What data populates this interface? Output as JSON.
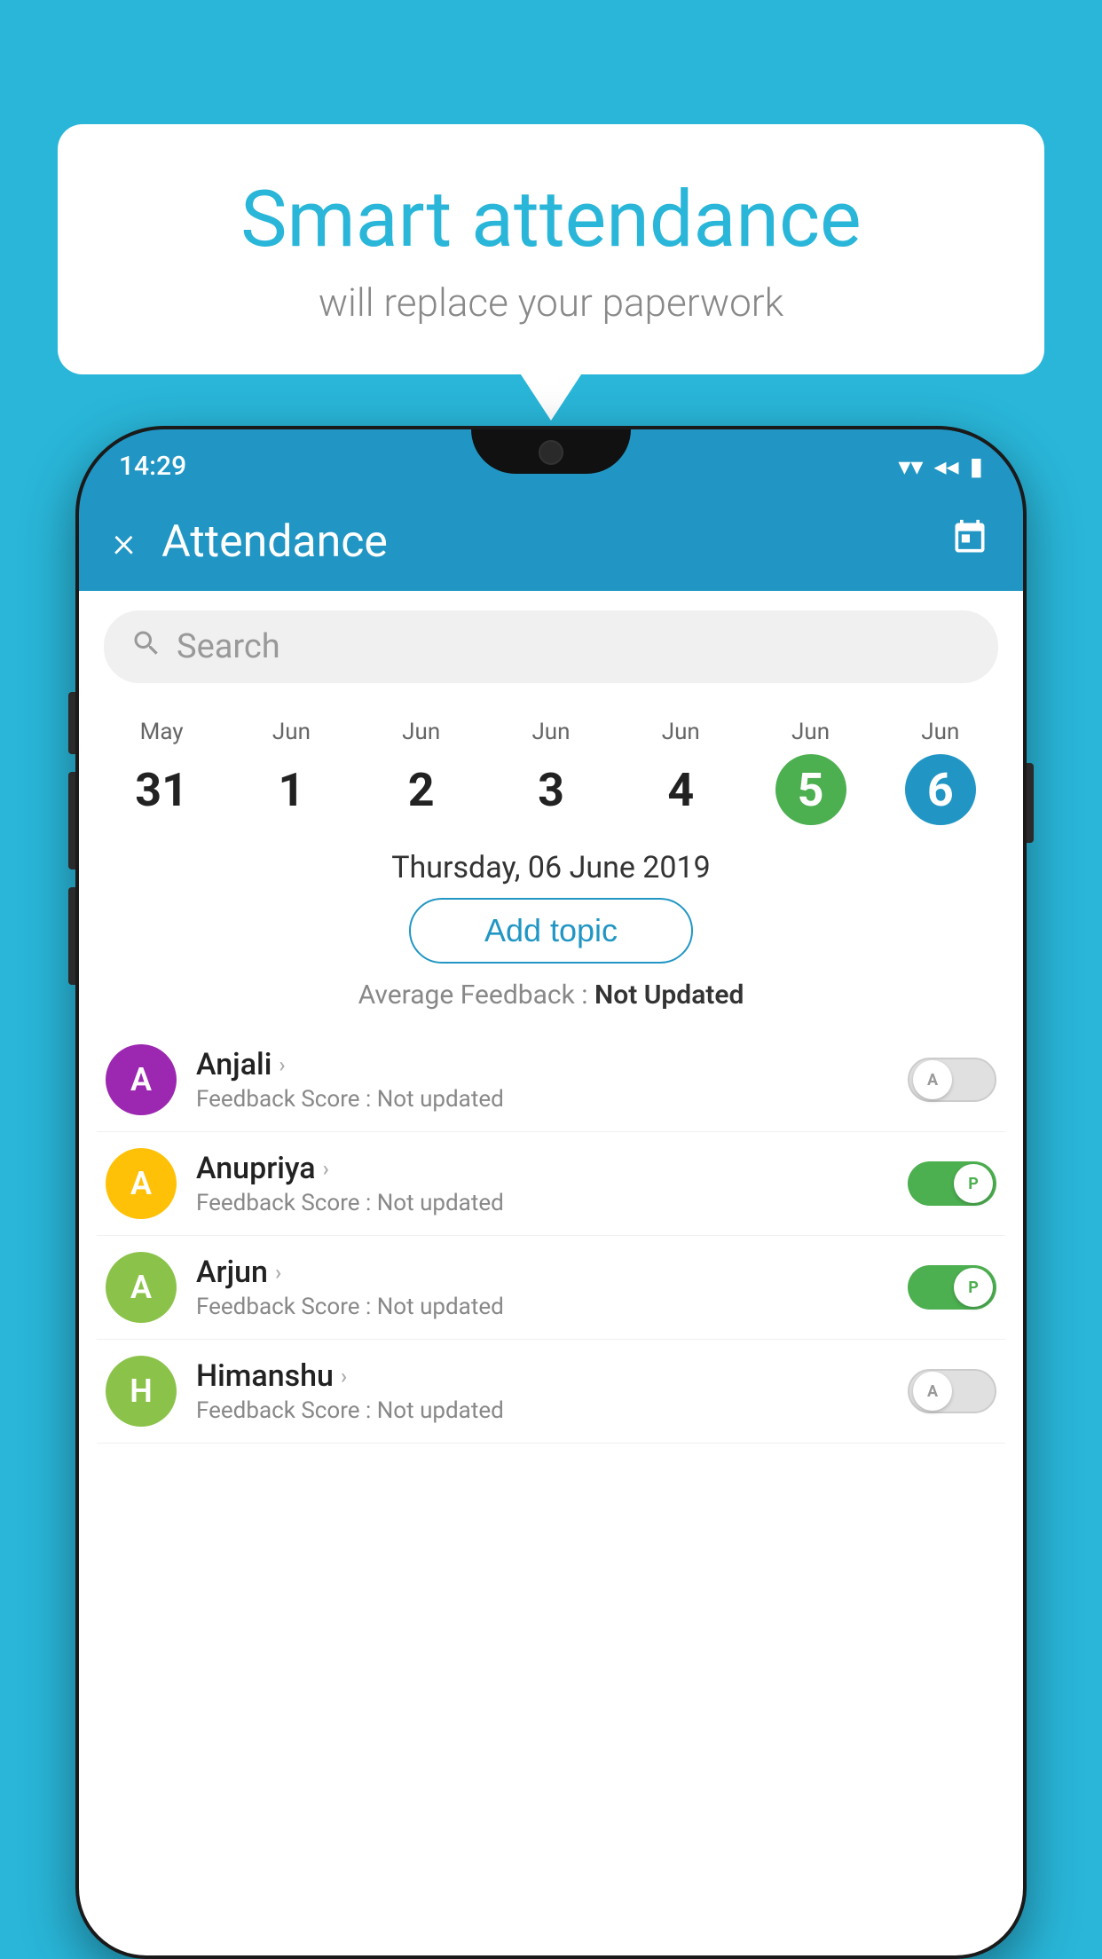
{
  "bubble": {
    "title": "Smart attendance",
    "subtitle": "will replace your paperwork"
  },
  "statusBar": {
    "time": "14:29",
    "wifi": "▾",
    "signal": "◂",
    "battery": "▮"
  },
  "appBar": {
    "title": "Attendance",
    "closeLabel": "×",
    "calendarLabel": "📅"
  },
  "search": {
    "placeholder": "Search"
  },
  "calendar": {
    "days": [
      {
        "month": "May",
        "date": "31",
        "state": "normal"
      },
      {
        "month": "Jun",
        "date": "1",
        "state": "normal"
      },
      {
        "month": "Jun",
        "date": "2",
        "state": "normal"
      },
      {
        "month": "Jun",
        "date": "3",
        "state": "normal"
      },
      {
        "month": "Jun",
        "date": "4",
        "state": "normal"
      },
      {
        "month": "Jun",
        "date": "5",
        "state": "today"
      },
      {
        "month": "Jun",
        "date": "6",
        "state": "selected"
      }
    ]
  },
  "selectedDate": "Thursday, 06 June 2019",
  "addTopicLabel": "Add topic",
  "averageFeedback": {
    "label": "Average Feedback : ",
    "value": "Not Updated"
  },
  "students": [
    {
      "name": "Anjali",
      "initial": "A",
      "avatarColor": "#9c27b0",
      "score": "Feedback Score : Not updated",
      "toggleState": "off",
      "toggleLabel": "A"
    },
    {
      "name": "Anupriya",
      "initial": "A",
      "avatarColor": "#ffc107",
      "score": "Feedback Score : Not updated",
      "toggleState": "on",
      "toggleLabel": "P"
    },
    {
      "name": "Arjun",
      "initial": "A",
      "avatarColor": "#8bc34a",
      "score": "Feedback Score : Not updated",
      "toggleState": "on",
      "toggleLabel": "P"
    },
    {
      "name": "Himanshu",
      "initial": "H",
      "avatarColor": "#8bc34a",
      "score": "Feedback Score : Not updated",
      "toggleState": "off",
      "toggleLabel": "A"
    }
  ]
}
